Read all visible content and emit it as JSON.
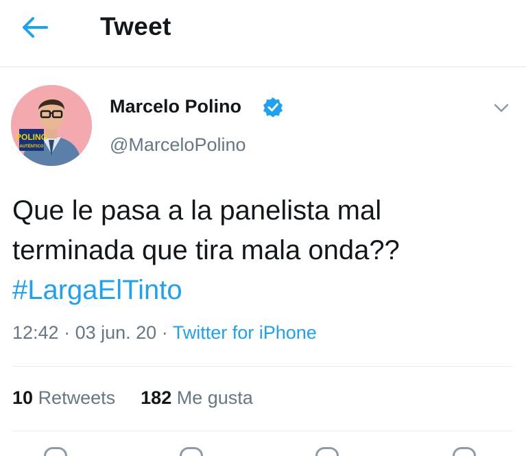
{
  "header": {
    "back_icon": "arrow-left-icon",
    "title": "Tweet"
  },
  "author": {
    "name": "Marcelo Polino",
    "handle": "@MarceloPolino",
    "verified_icon": "verified-badge-icon",
    "avatar_logo_line1": "POLINO",
    "avatar_logo_line2": "AUTÉNTICO"
  },
  "tweet": {
    "lines": [
      "Que le pasa a la panelista mal",
      "terminada que tira mala onda??"
    ],
    "hashtag": "#LargaElTinto",
    "time": "12:42",
    "sep1": " · ",
    "date": "03 jun. 20",
    "sep2": " · ",
    "source": "Twitter for iPhone"
  },
  "stats": {
    "retweets_count": "10",
    "retweets_label": "Retweets",
    "likes_count": "182",
    "likes_label": "Me gusta"
  },
  "colors": {
    "accent": "#1da1f2",
    "text": "#14171a",
    "secondary": "#657786",
    "avatar_bg": "#f3a9ad"
  }
}
